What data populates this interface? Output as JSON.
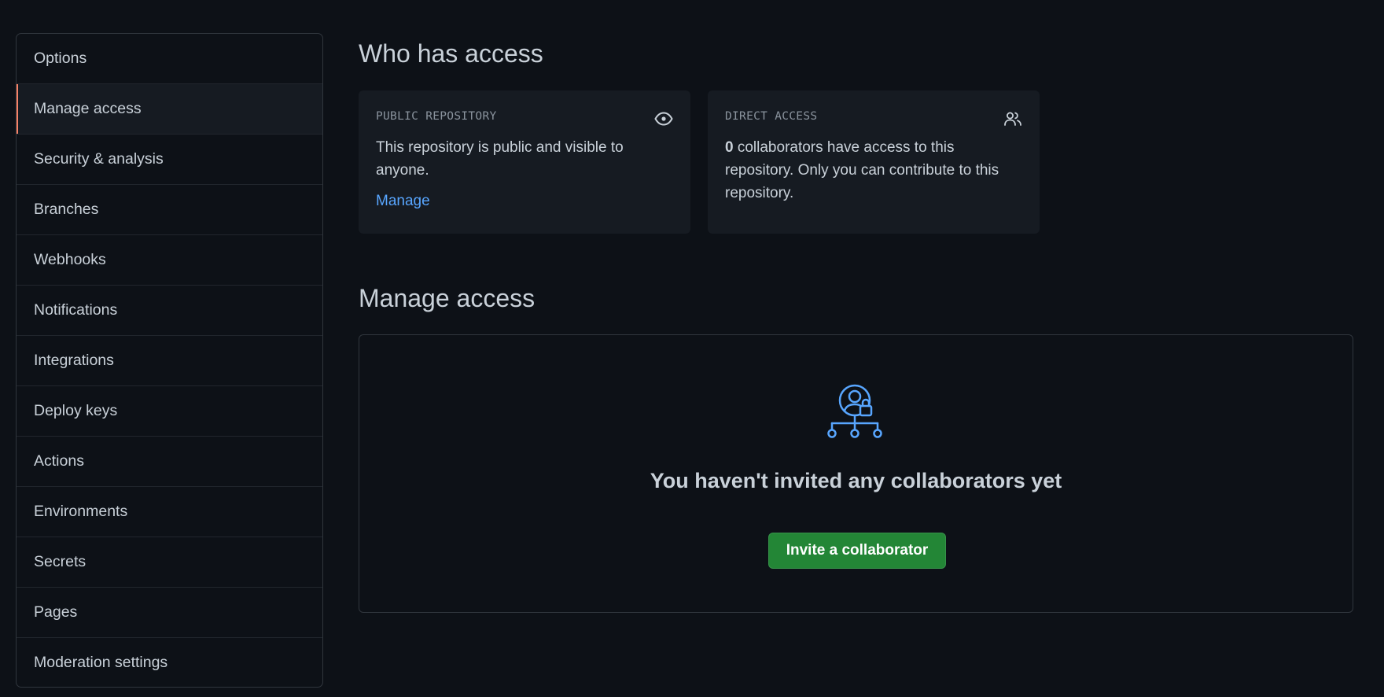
{
  "sidebar": {
    "selected_index": 1,
    "items": [
      {
        "label": "Options"
      },
      {
        "label": "Manage access"
      },
      {
        "label": "Security & analysis"
      },
      {
        "label": "Branches"
      },
      {
        "label": "Webhooks"
      },
      {
        "label": "Notifications"
      },
      {
        "label": "Integrations"
      },
      {
        "label": "Deploy keys"
      },
      {
        "label": "Actions"
      },
      {
        "label": "Environments"
      },
      {
        "label": "Secrets"
      },
      {
        "label": "Pages"
      },
      {
        "label": "Moderation settings"
      }
    ]
  },
  "who_has_access": {
    "title": "Who has access",
    "public_card": {
      "label": "PUBLIC REPOSITORY",
      "icon": "eye-icon",
      "text": "This repository is public and visible to anyone.",
      "link": "Manage"
    },
    "direct_card": {
      "label": "DIRECT ACCESS",
      "icon": "people-icon",
      "count": "0",
      "text": " collaborators have access to this repository. Only you can contribute to this repository."
    }
  },
  "manage_access": {
    "title": "Manage access",
    "empty_icon": "collaborators-lock-icon",
    "empty_title": "You haven't invited any collaborators yet",
    "invite_button": "Invite a collaborator"
  },
  "colors": {
    "background": "#0d1117",
    "card_background": "#161b22",
    "border": "#30363d",
    "link": "#58a6ff",
    "button_green": "#238636",
    "selected_marker": "#f78166"
  }
}
